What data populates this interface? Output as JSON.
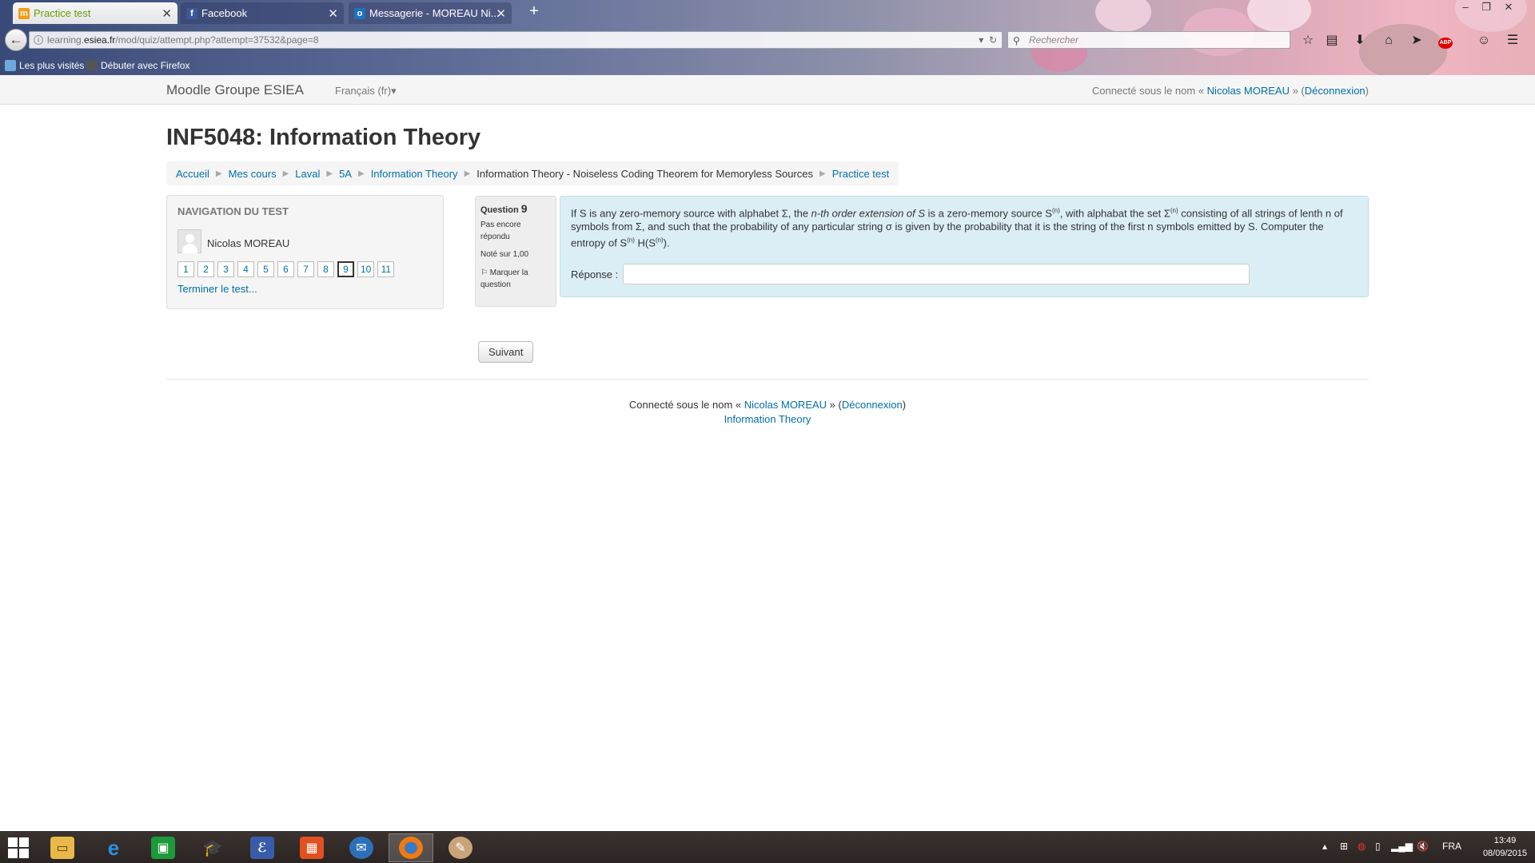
{
  "browser": {
    "tabs": [
      {
        "label": "Practice test",
        "active": true
      },
      {
        "label": "Facebook",
        "active": false
      },
      {
        "label": "Messagerie - MOREAU Ni...",
        "active": false
      }
    ],
    "url_prefix": "learning.",
    "url_domain": "esiea.fr",
    "url_path": "/mod/quiz/attempt.php?attempt=37532&page=8",
    "search_placeholder": "Rechercher",
    "bookmarks": [
      "Les plus visités",
      "Débuter avec Firefox"
    ]
  },
  "moodle": {
    "site_name": "Moodle Groupe ESIEA",
    "language": "Français (fr)",
    "login_prefix": "Connecté sous le nom «",
    "user_name": "Nicolas MOREAU",
    "login_mid": "» (",
    "logout": "Déconnexion",
    "login_suffix": ")"
  },
  "course": {
    "title": "INF5048: Information Theory",
    "breadcrumb": [
      "Accueil",
      "Mes cours",
      "Laval",
      "5A",
      "Information Theory",
      "Information Theory - Noiseless Coding Theorem for Memoryless Sources",
      "Practice test"
    ]
  },
  "quiz_nav": {
    "title": "Navigation du test",
    "user_name": "Nicolas MOREAU",
    "questions": [
      "1",
      "2",
      "3",
      "4",
      "5",
      "6",
      "7",
      "8",
      "9",
      "10",
      "11"
    ],
    "current": "9",
    "finish_label": "Terminer le test..."
  },
  "question": {
    "label": "Question",
    "number": "9",
    "state": "Pas encore répondu",
    "grade": "Noté sur 1,00",
    "flag_label": "Marquer la question",
    "text_1": "If S is any zero-memory source with alphabet Σ, the ",
    "text_em": "n-th order extension of S",
    "text_2": " is a zero-memory source S",
    "sup": "(n)",
    "text_3": ", with alphabat the set Σ",
    "text_4": " consisting of all strings of lenth n of symbols from Σ, and such that the probability of any particular string σ is given by the probability that it is the string of the first n symbols emitted by S. Computer the entropy of S",
    "text_5": " H(S",
    "text_6": ").",
    "answer_label": "Réponse :",
    "answer_value": ""
  },
  "next_button": "Suivant",
  "footer": {
    "course_link": "Information Theory"
  },
  "taskbar": {
    "lang": "FRA",
    "time": "13:49",
    "date": "08/09/2015"
  }
}
